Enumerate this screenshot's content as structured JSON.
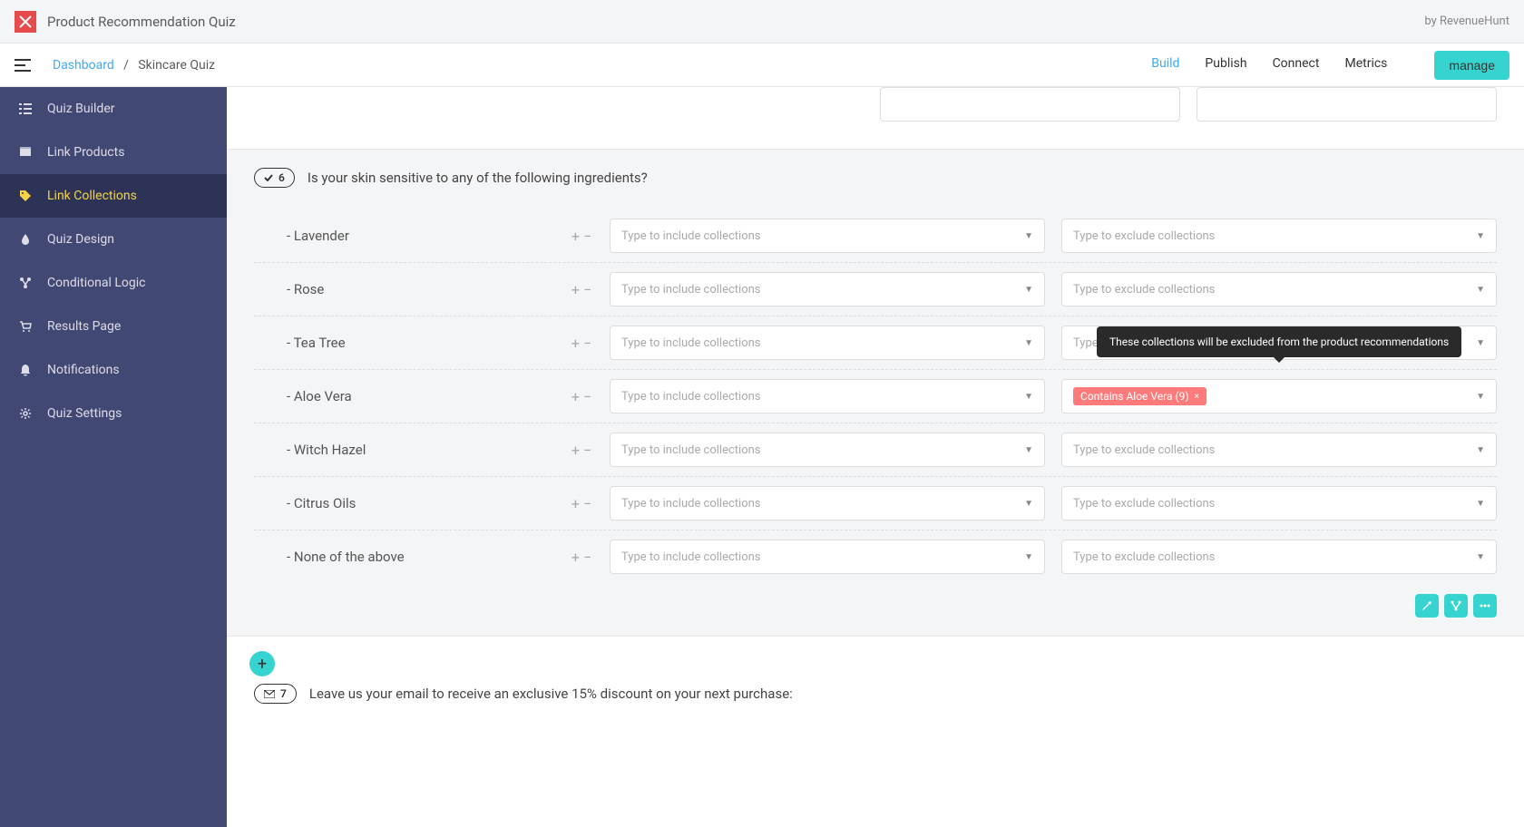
{
  "header": {
    "app_title": "Product Recommendation Quiz",
    "by_text": "by RevenueHunt"
  },
  "breadcrumb": {
    "dashboard": "Dashboard",
    "separator": "/",
    "current": "Skincare Quiz"
  },
  "nav_tabs": {
    "build": "Build",
    "publish": "Publish",
    "connect": "Connect",
    "metrics": "Metrics"
  },
  "manage_button": "manage",
  "sidebar": {
    "items": [
      {
        "label": "Quiz Builder",
        "icon": "list"
      },
      {
        "label": "Link Products",
        "icon": "box"
      },
      {
        "label": "Link Collections",
        "icon": "tag",
        "active": true
      },
      {
        "label": "Quiz Design",
        "icon": "drop"
      },
      {
        "label": "Conditional Logic",
        "icon": "branch"
      },
      {
        "label": "Results Page",
        "icon": "cart"
      },
      {
        "label": "Notifications",
        "icon": "bell"
      },
      {
        "label": "Quiz Settings",
        "icon": "gear"
      }
    ]
  },
  "question6": {
    "number": "6",
    "text": "Is your skin sensitive to any of the following ingredients?",
    "include_placeholder": "Type to include collections",
    "exclude_placeholder": "Type to exclude collections",
    "tooltip": "These collections will be excluded from the product recommendations",
    "answers": [
      {
        "label": "- Lavender"
      },
      {
        "label": "- Rose"
      },
      {
        "label": "- Tea Tree"
      },
      {
        "label": "- Aloe Vera",
        "exclude_tag": "Contains Aloe Vera (9)"
      },
      {
        "label": "- Witch Hazel"
      },
      {
        "label": "- Citrus Oils"
      },
      {
        "label": "- None of the above"
      }
    ]
  },
  "question7": {
    "number": "7",
    "text": "Leave us your email to receive an exclusive 15% discount on your next purchase:"
  }
}
